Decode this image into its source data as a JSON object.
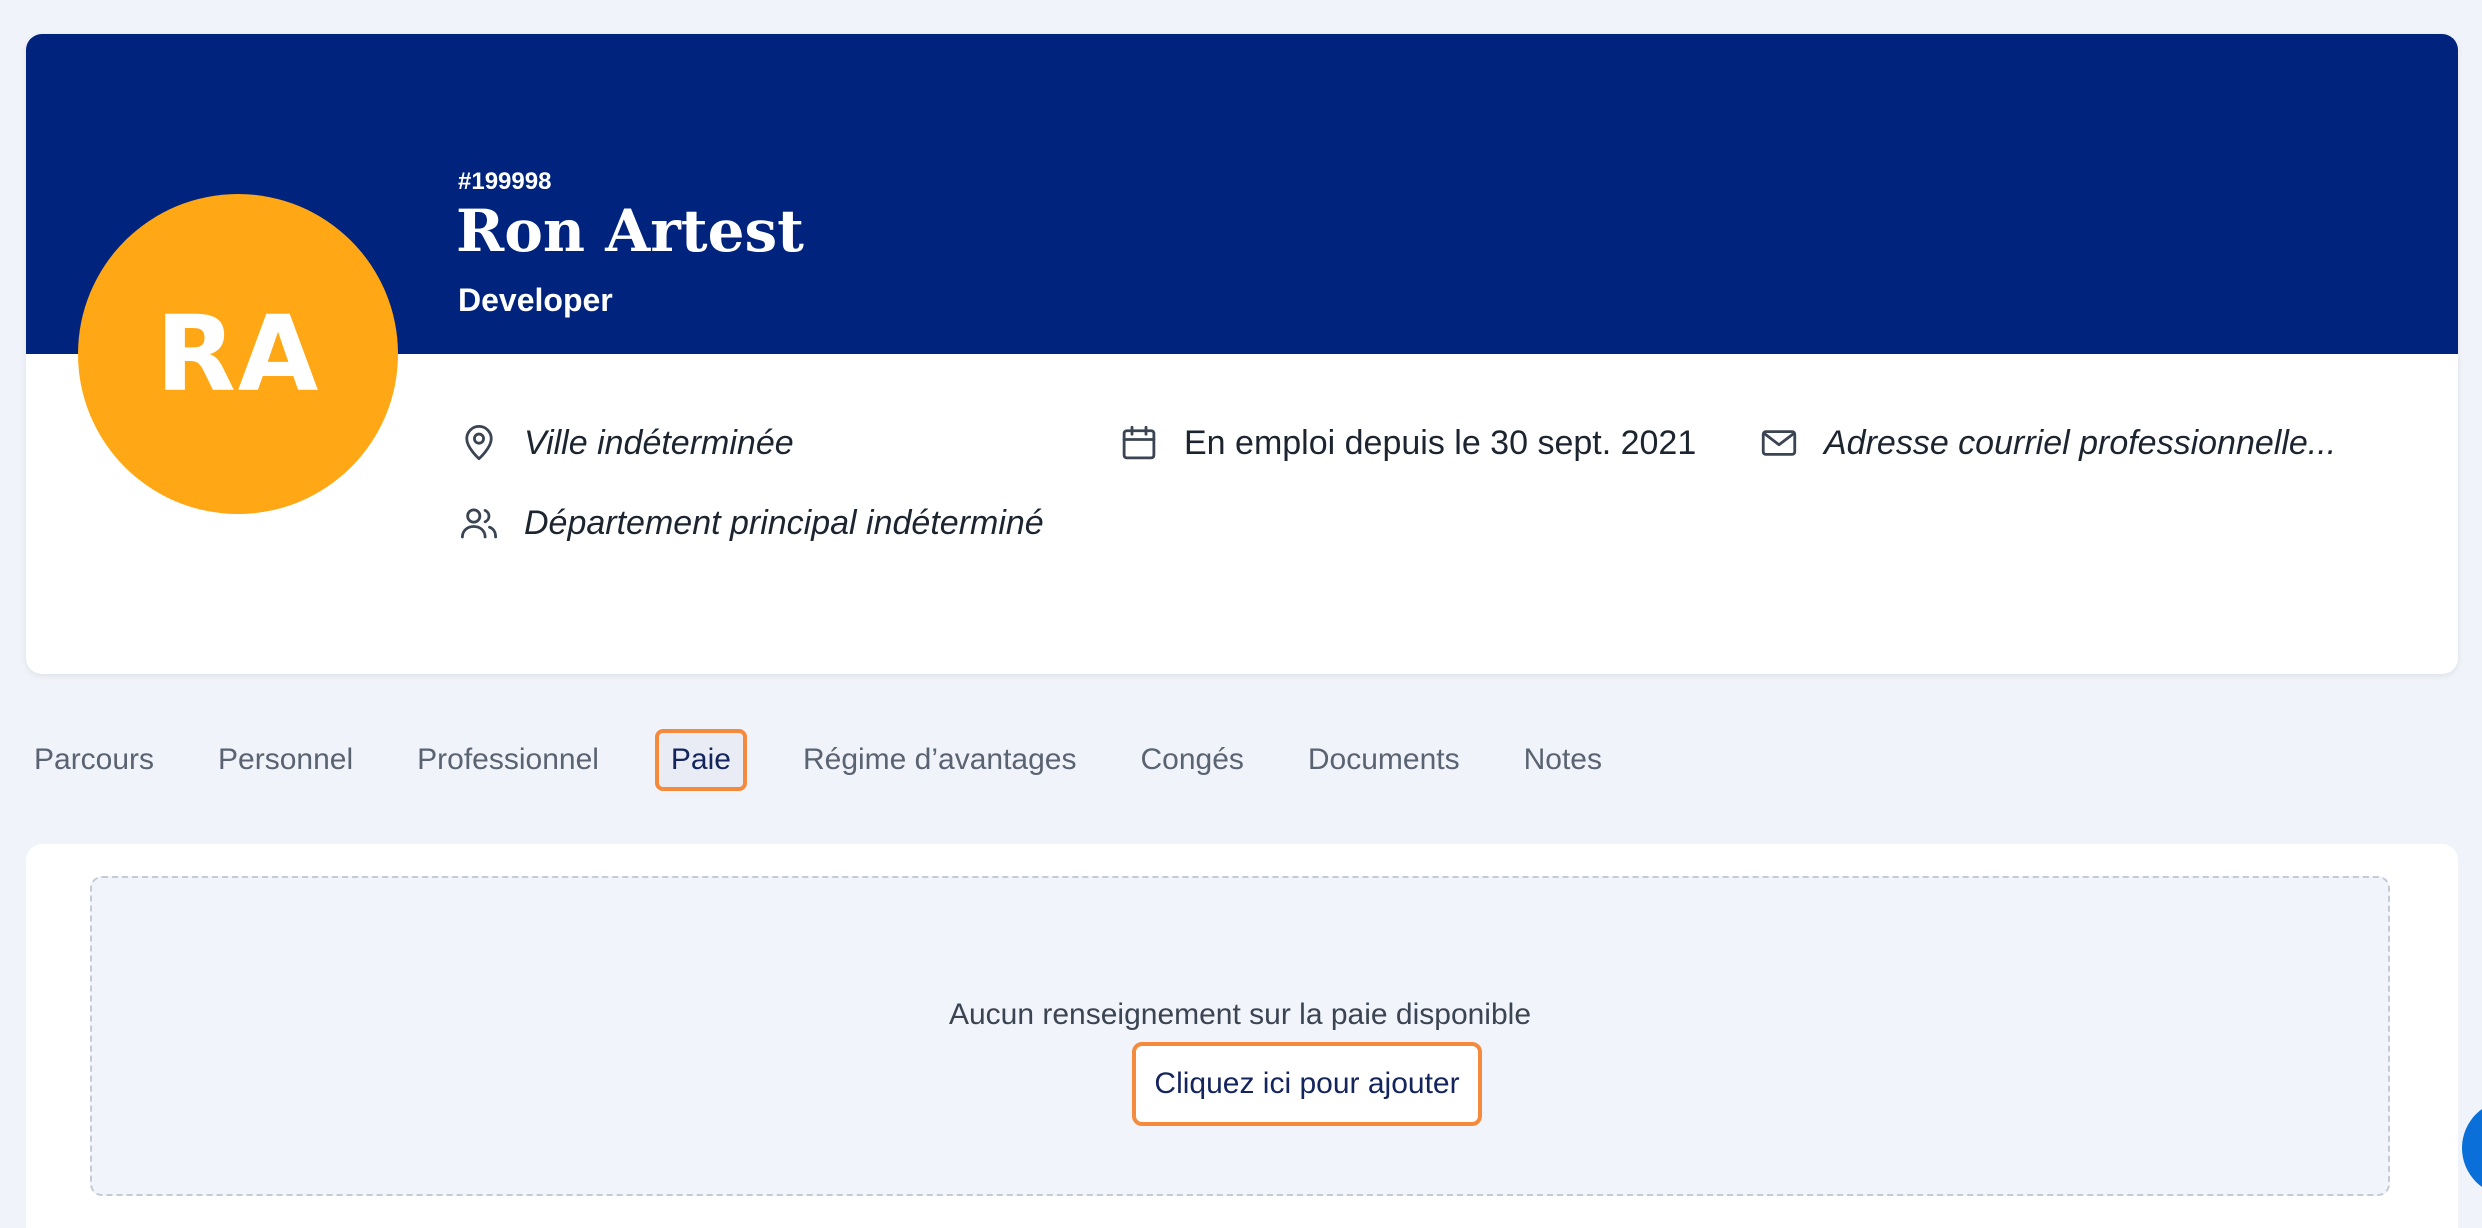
{
  "employee": {
    "id": "#199998",
    "name": "Ron Artest",
    "title": "Developer",
    "initials": "RA"
  },
  "info": {
    "city": "Ville indéterminée",
    "department": "Département principal indéterminé",
    "employment": "En emploi depuis le 30 sept. 2021",
    "email": "Adresse courriel professionnelle..."
  },
  "tabs": [
    {
      "label": "Parcours"
    },
    {
      "label": "Personnel"
    },
    {
      "label": "Professionnel"
    },
    {
      "label": "Paie",
      "active": true
    },
    {
      "label": "Régime d’avantages"
    },
    {
      "label": "Congés"
    },
    {
      "label": "Documents"
    },
    {
      "label": "Notes"
    }
  ],
  "payroll": {
    "empty_message": "Aucun renseignement sur la paie disponible",
    "add_label": "Cliquez ici pour ajouter"
  },
  "colors": {
    "banner": "#00247d",
    "avatar": "#ffa714",
    "highlight": "#f58a3c"
  }
}
